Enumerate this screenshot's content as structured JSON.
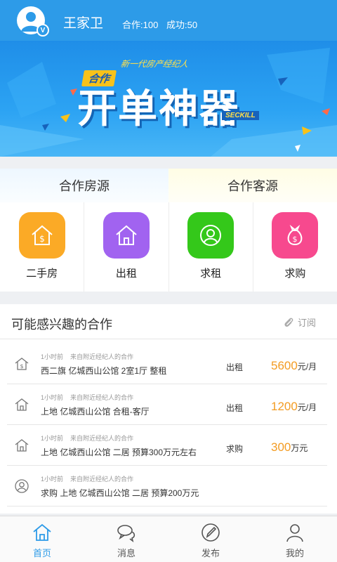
{
  "header": {
    "user_name": "王家卫",
    "verified_badge": "V",
    "cooperation": "合作:100",
    "success": "成功:50"
  },
  "banner": {
    "subtitle": "新一代房产经纪人",
    "tag": "合作",
    "main_title": "开单神器",
    "seckill": "SECKILL"
  },
  "cooperation": {
    "tabs": [
      "合作房源",
      "合作客源"
    ],
    "items": [
      {
        "label": "二手房",
        "icon": "house-dollar-icon",
        "color": "#fbaa26"
      },
      {
        "label": "出租",
        "icon": "house-icon",
        "color": "#a163f0"
      },
      {
        "label": "求租",
        "icon": "user-circle-icon",
        "color": "#34c81a"
      },
      {
        "label": "求购",
        "icon": "money-bag-icon",
        "color": "#f7498e"
      }
    ]
  },
  "interest": {
    "title": "可能感兴趣的合作",
    "subscribe": "订阅",
    "rows": [
      {
        "time": "1小时前",
        "source": "来自附近经纪人的合作",
        "desc": "西二旗 亿城西山公馆 2室1厅 整租",
        "type": "出租",
        "price": "5600",
        "unit": "元/月",
        "icon": "house-dollar-icon"
      },
      {
        "time": "1小时前",
        "source": "来自附近经纪人的合作",
        "desc": "上地 亿城西山公馆 合租-客厅",
        "type": "出租",
        "price": "1200",
        "unit": "元/月",
        "icon": "house-icon"
      },
      {
        "time": "1小时前",
        "source": "来自附近经纪人的合作",
        "desc": "上地 亿城西山公馆 二居 预算300万元左右",
        "type": "求购",
        "price": "300",
        "unit": "万元",
        "icon": "house-icon"
      },
      {
        "time": "1小时前",
        "source": "来自附近经纪人的合作",
        "desc": "求购 上地 亿城西山公馆 二居 预算200万元",
        "type": "",
        "price": "",
        "unit": "",
        "icon": "user-circle-icon"
      }
    ]
  },
  "nav": {
    "items": [
      {
        "label": "首页",
        "icon": "home-icon",
        "active": true
      },
      {
        "label": "消息",
        "icon": "chat-icon",
        "active": false
      },
      {
        "label": "发布",
        "icon": "compose-icon",
        "active": false
      },
      {
        "label": "我的",
        "icon": "person-icon",
        "active": false
      }
    ]
  },
  "colors": {
    "primary": "#2d9be8",
    "price": "#f39c23"
  }
}
